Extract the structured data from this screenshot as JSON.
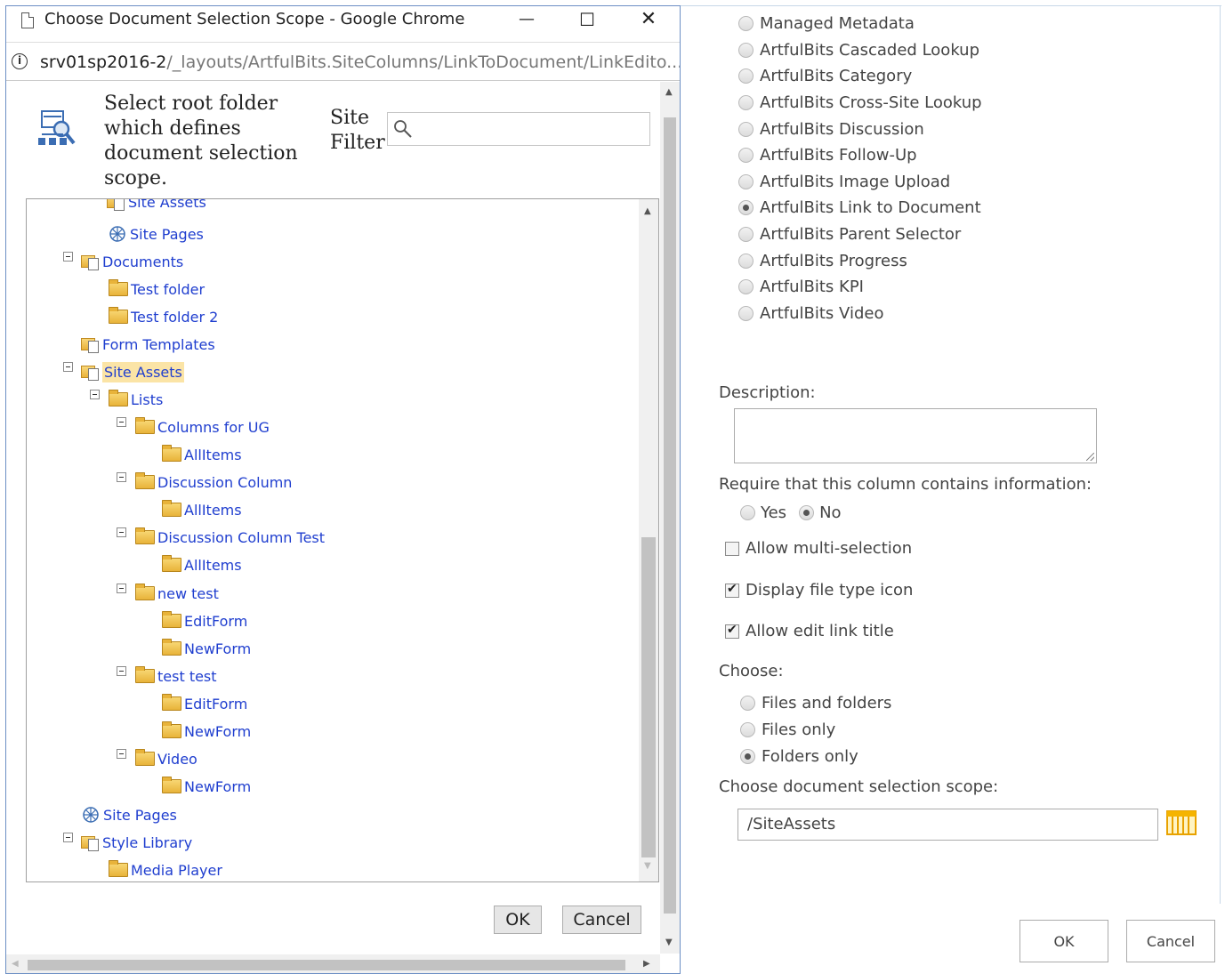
{
  "background_page": {
    "field_types": [
      {
        "label": "Managed Metadata",
        "selected": false
      },
      {
        "label": "ArtfulBits Cascaded Lookup",
        "selected": false
      },
      {
        "label": "ArtfulBits Category",
        "selected": false
      },
      {
        "label": "ArtfulBits Cross-Site Lookup",
        "selected": false
      },
      {
        "label": "ArtfulBits Discussion",
        "selected": false
      },
      {
        "label": "ArtfulBits Follow-Up",
        "selected": false
      },
      {
        "label": "ArtfulBits Image Upload",
        "selected": false
      },
      {
        "label": "ArtfulBits Link to Document",
        "selected": true
      },
      {
        "label": "ArtfulBits Parent Selector",
        "selected": false
      },
      {
        "label": "ArtfulBits Progress",
        "selected": false
      },
      {
        "label": "ArtfulBits KPI",
        "selected": false
      },
      {
        "label": "ArtfulBits Video",
        "selected": false
      }
    ],
    "description_label": "Description:",
    "description_value": "",
    "require_label": "Require that this column contains information:",
    "require_yes": "Yes",
    "require_no": "No",
    "allow_multi_label": "Allow multi-selection",
    "allow_multi_checked": false,
    "display_icon_label": "Display file type icon",
    "display_icon_checked": true,
    "allow_edit_title_label": "Allow edit link title",
    "allow_edit_title_checked": true,
    "choose_label": "Choose:",
    "choose_options": [
      {
        "label": "Files and folders",
        "selected": false
      },
      {
        "label": "Files only",
        "selected": false
      },
      {
        "label": "Folders only",
        "selected": true
      }
    ],
    "scope_label": "Choose document selection scope:",
    "scope_value": "/SiteAssets",
    "ok_label": "OK",
    "cancel_label": "Cancel"
  },
  "popup": {
    "window_title": "Choose Document Selection Scope - Google Chrome",
    "url_host": "srv01sp2016-2",
    "url_path": "/_layouts/ArtfulBits.SiteColumns/LinkToDocument/LinkEdito...",
    "header_text": "Select root folder which defines document selection scope.",
    "site_filter_label": "Site Filter",
    "filter_value": "",
    "tree": [
      {
        "label": "Site Assets",
        "icon": "library-icon"
      },
      {
        "label": "Site Pages",
        "icon": "site-pages-icon"
      },
      {
        "label": "Documents",
        "icon": "library-icon"
      },
      {
        "label": "Test folder",
        "icon": "folder-icon"
      },
      {
        "label": "Test folder 2",
        "icon": "folder-icon"
      },
      {
        "label": "Form Templates",
        "icon": "library-icon"
      },
      {
        "label": "Site Assets",
        "icon": "library-icon",
        "selected": true
      },
      {
        "label": "Lists",
        "icon": "folder-icon"
      },
      {
        "label": "Columns for UG",
        "icon": "folder-icon"
      },
      {
        "label": "AllItems",
        "icon": "folder-icon"
      },
      {
        "label": "Discussion Column",
        "icon": "folder-icon"
      },
      {
        "label": "AllItems",
        "icon": "folder-icon"
      },
      {
        "label": "Discussion Column Test",
        "icon": "folder-icon"
      },
      {
        "label": "AllItems",
        "icon": "folder-icon"
      },
      {
        "label": "new test",
        "icon": "folder-icon"
      },
      {
        "label": "EditForm",
        "icon": "folder-icon"
      },
      {
        "label": "NewForm",
        "icon": "folder-icon"
      },
      {
        "label": "test test",
        "icon": "folder-icon"
      },
      {
        "label": "EditForm",
        "icon": "folder-icon"
      },
      {
        "label": "NewForm",
        "icon": "folder-icon"
      },
      {
        "label": "Video",
        "icon": "folder-icon"
      },
      {
        "label": "NewForm",
        "icon": "folder-icon"
      },
      {
        "label": "Site Pages",
        "icon": "site-pages-icon"
      },
      {
        "label": "Style Library",
        "icon": "library-icon"
      },
      {
        "label": "Media Player",
        "icon": "folder-icon"
      }
    ],
    "ok_label": "OK",
    "cancel_label": "Cancel",
    "accent_color": "#1f3ecf",
    "selection_color": "#fbe4a6"
  }
}
